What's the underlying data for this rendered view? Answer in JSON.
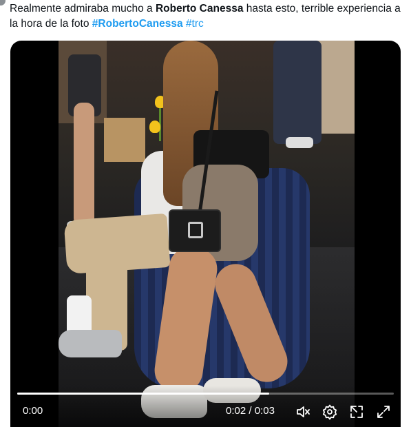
{
  "tweet": {
    "text_plain_1": "Realmente admiraba mucho a ",
    "text_bold": "Roberto Canessa",
    "text_plain_2": " hasta esto, terrible experiencia a la hora de la foto ",
    "hashtag_1": "#RobertoCanessa",
    "hashtag_2": "#trc"
  },
  "video": {
    "current_time_left": "0:00",
    "current_time": "0:02",
    "separator": " / ",
    "duration": "0:03",
    "progress_fraction": 0.67
  },
  "icons": {
    "mute": "mute-icon",
    "settings": "gear-icon",
    "popout": "popout-icon",
    "fullscreen": "fullscreen-icon"
  },
  "colors": {
    "link": "#1d9bf0",
    "text": "#0f1419",
    "media_bg": "#000000"
  }
}
